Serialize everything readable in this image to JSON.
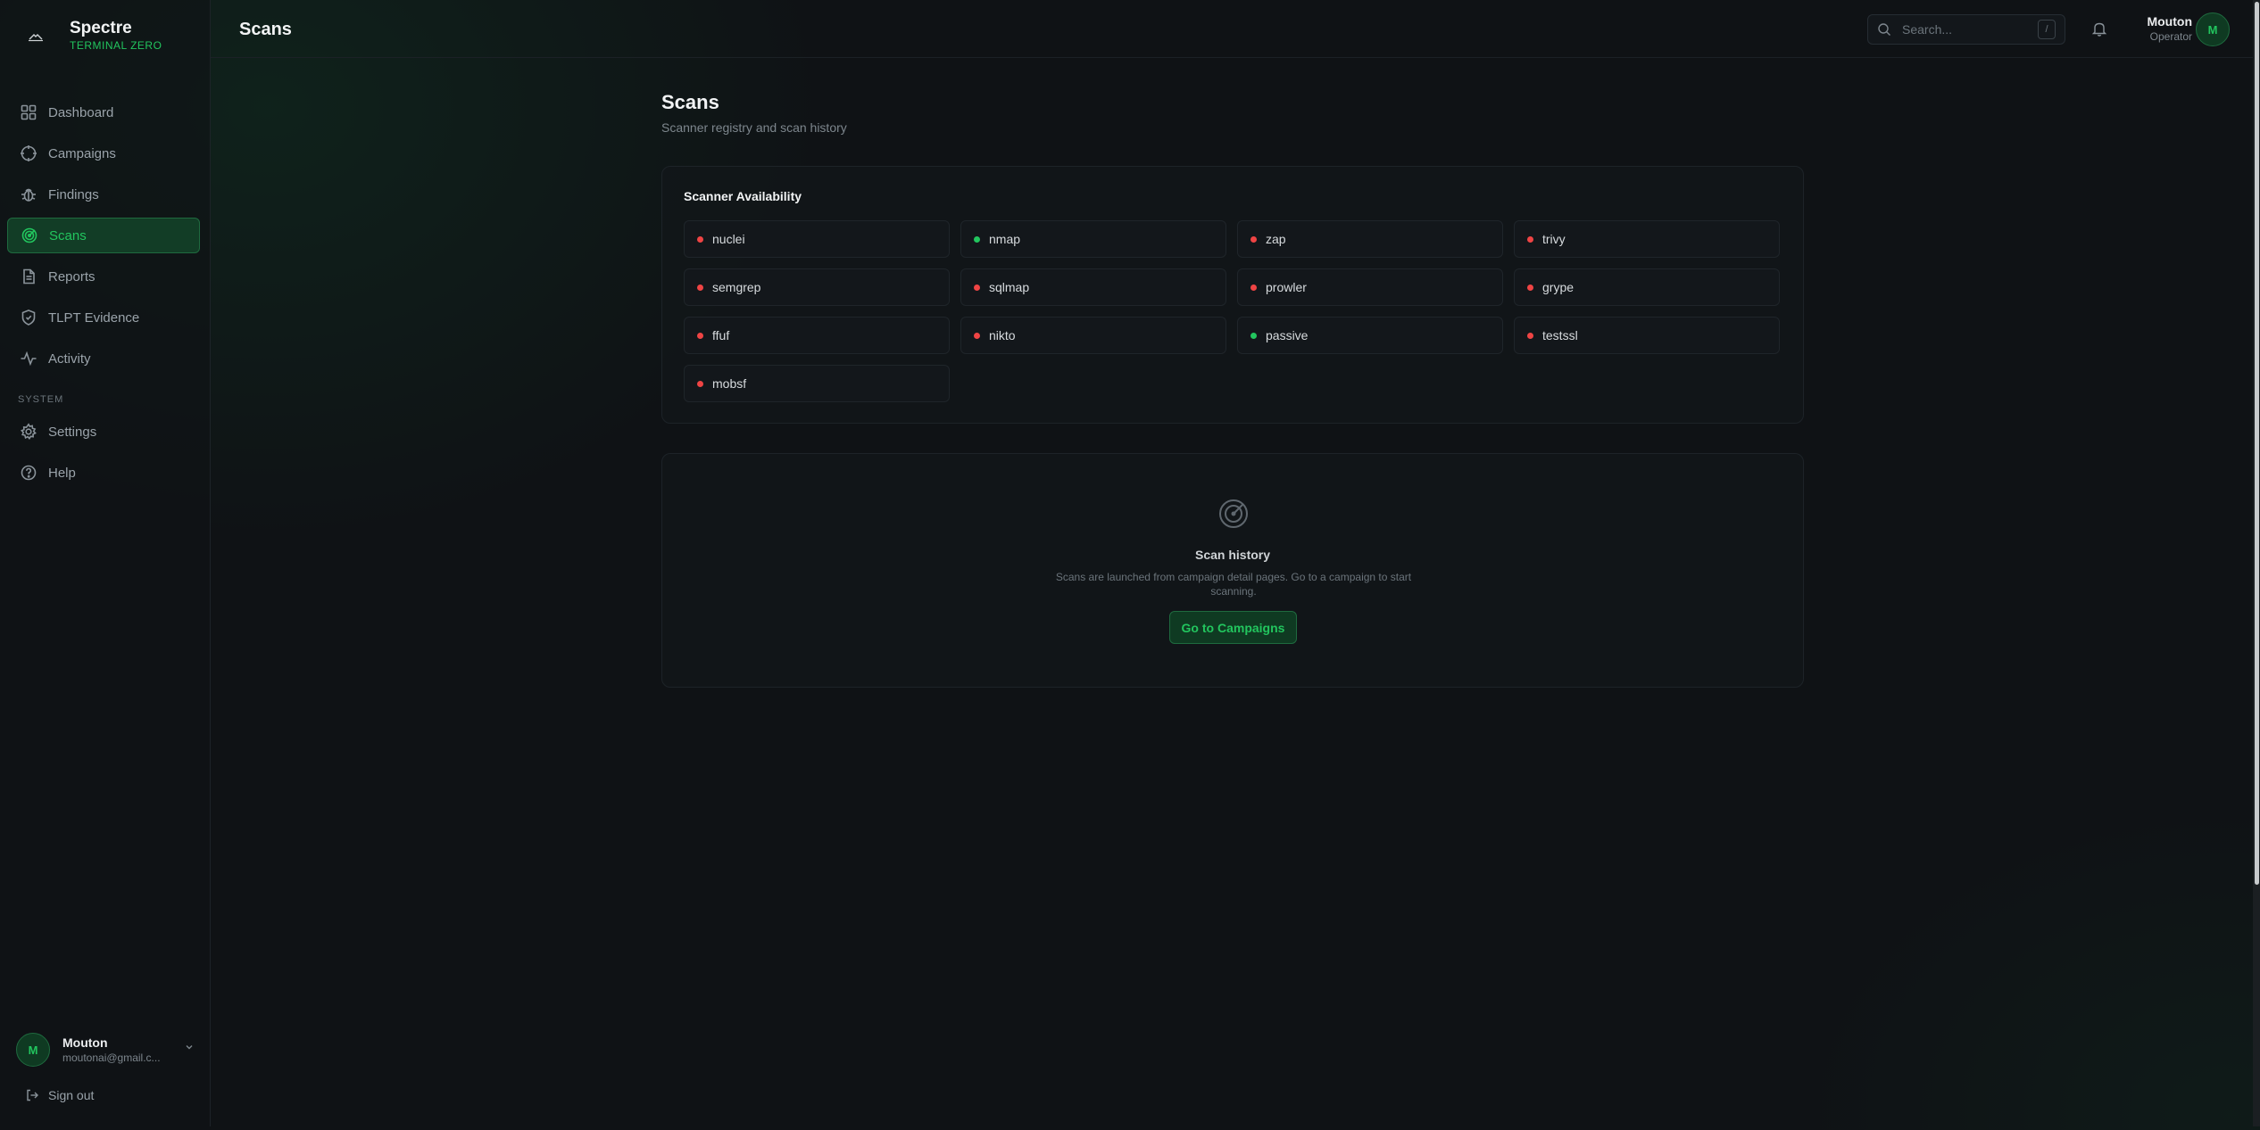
{
  "brand": {
    "name": "Spectre",
    "subtitle": "TERMINAL ZERO",
    "logo_icon": "ridge-logo-icon"
  },
  "sidebar": {
    "items": [
      {
        "label": "Dashboard",
        "icon": "grid-icon"
      },
      {
        "label": "Campaigns",
        "icon": "crosshair-icon"
      },
      {
        "label": "Findings",
        "icon": "bug-icon"
      },
      {
        "label": "Scans",
        "icon": "radar-icon",
        "active": true
      },
      {
        "label": "Reports",
        "icon": "document-icon"
      },
      {
        "label": "TLPT Evidence",
        "icon": "shield-icon"
      },
      {
        "label": "Activity",
        "icon": "activity-icon"
      }
    ],
    "section_label": "SYSTEM",
    "system_items": [
      {
        "label": "Settings",
        "icon": "gear-icon"
      },
      {
        "label": "Help",
        "icon": "help-icon"
      }
    ],
    "user": {
      "initial": "M",
      "name": "Mouton",
      "email": "moutonai@gmail.c..."
    },
    "signout_label": "Sign out"
  },
  "header": {
    "title": "Scans",
    "search_placeholder": "Search...",
    "search_shortcut": "/",
    "user": {
      "name": "Mouton",
      "role": "Operator",
      "initial": "M"
    }
  },
  "page": {
    "title": "Scans",
    "subtitle": "Scanner registry and scan history"
  },
  "availability": {
    "title": "Scanner Availability",
    "scanners": [
      {
        "name": "nuclei",
        "available": false
      },
      {
        "name": "nmap",
        "available": true
      },
      {
        "name": "zap",
        "available": false
      },
      {
        "name": "trivy",
        "available": false
      },
      {
        "name": "semgrep",
        "available": false
      },
      {
        "name": "sqlmap",
        "available": false
      },
      {
        "name": "prowler",
        "available": false
      },
      {
        "name": "grype",
        "available": false
      },
      {
        "name": "ffuf",
        "available": false
      },
      {
        "name": "nikto",
        "available": false
      },
      {
        "name": "passive",
        "available": true
      },
      {
        "name": "testssl",
        "available": false
      },
      {
        "name": "mobsf",
        "available": false
      }
    ]
  },
  "history": {
    "title": "Scan history",
    "text": "Scans are launched from campaign detail pages. Go to a campaign to start scanning.",
    "button_label": "Go to Campaigns"
  },
  "colors": {
    "accent": "#22c55e",
    "available": "#22c55e",
    "unavailable": "#ef4444",
    "background": "#0f1215"
  }
}
